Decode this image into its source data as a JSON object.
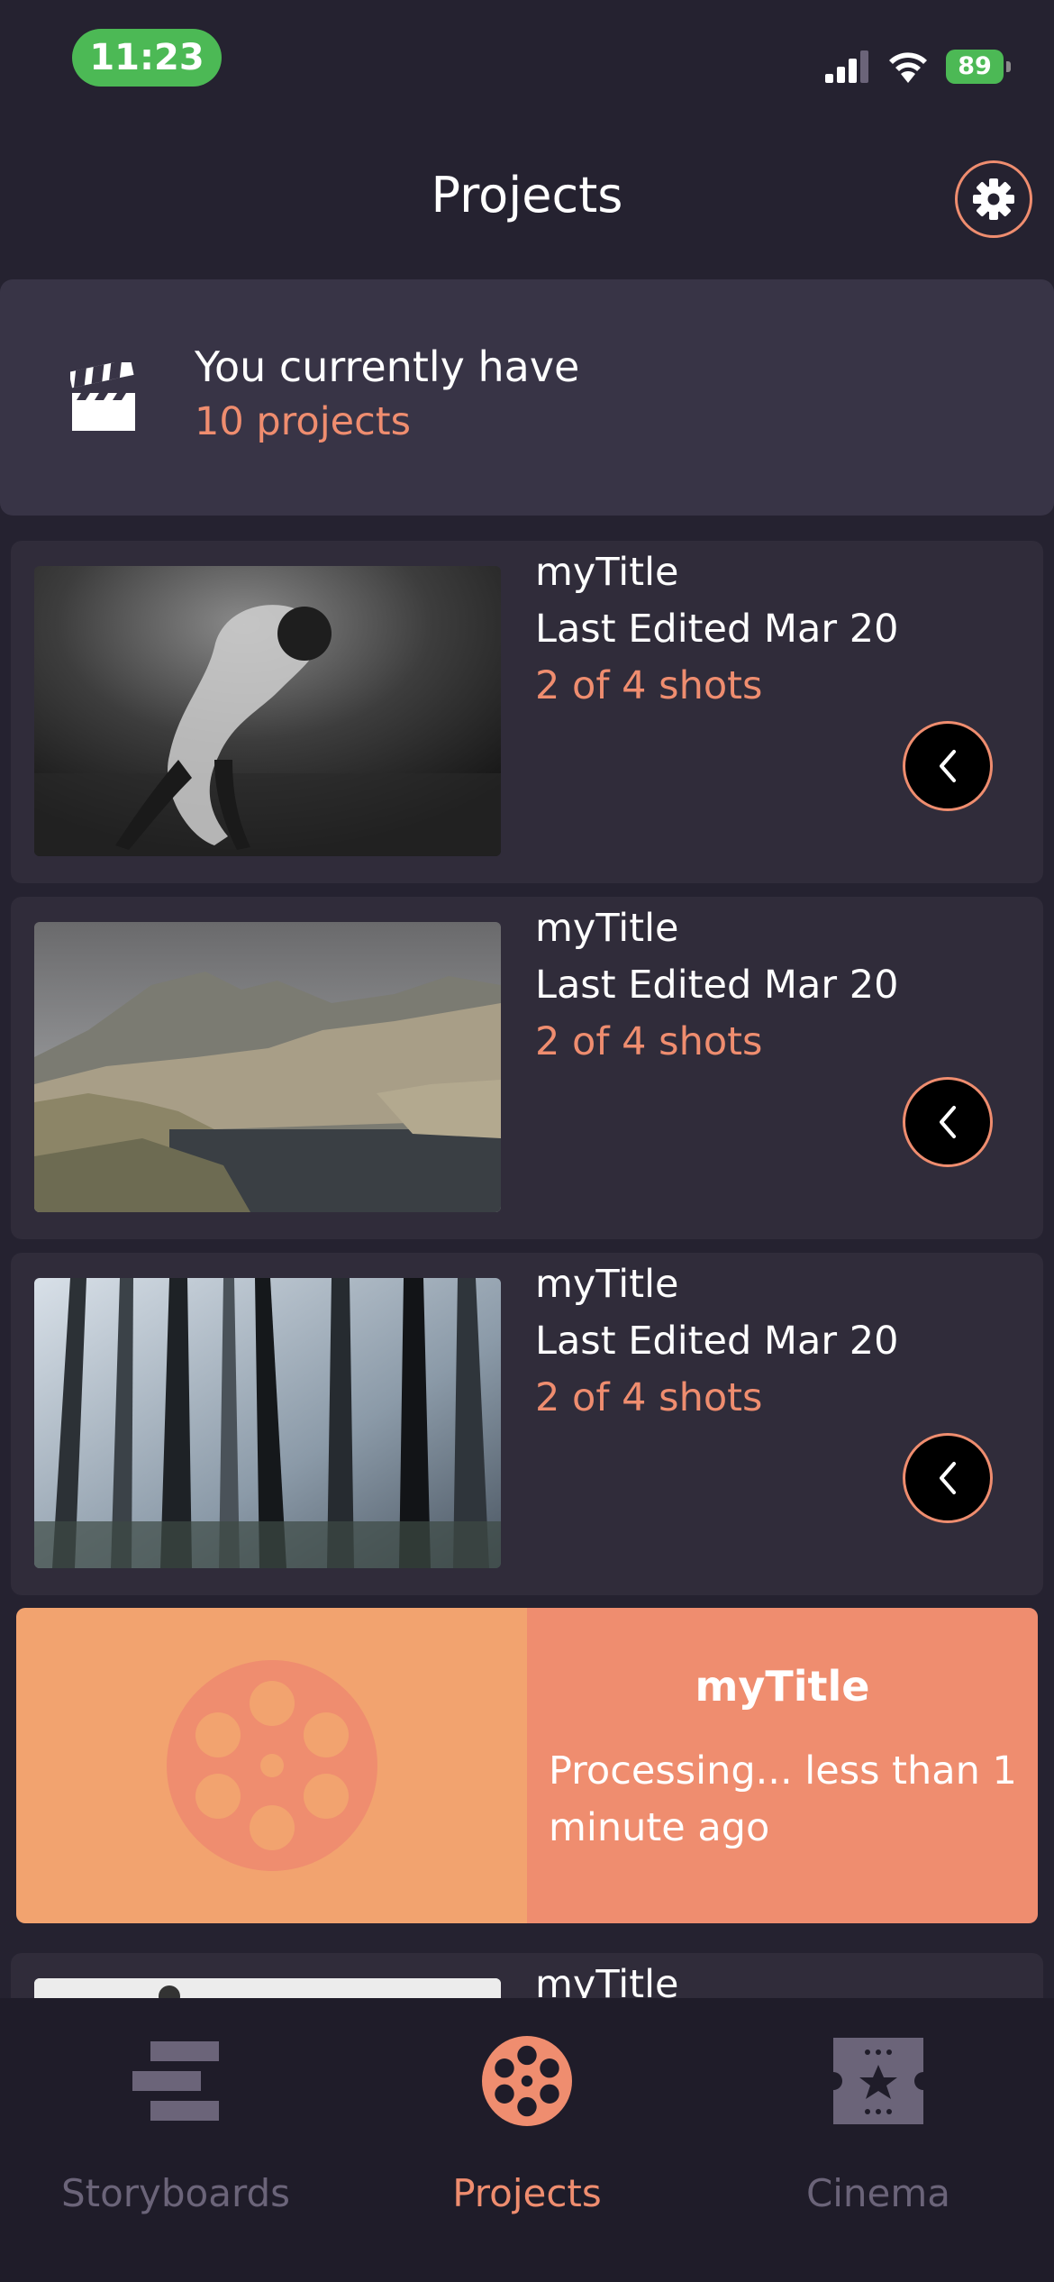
{
  "status_bar": {
    "time": "11:23",
    "battery": "89"
  },
  "header": {
    "title": "Projects"
  },
  "summary": {
    "line1": "You currently have",
    "line2": "10 projects"
  },
  "projects": [
    {
      "title": "myTitle",
      "edited": "Last Edited Mar 20",
      "shots": "2 of 4 shots"
    },
    {
      "title": "myTitle",
      "edited": "Last Edited Mar 20",
      "shots": "2 of 4 shots"
    },
    {
      "title": "myTitle",
      "edited": "Last Edited Mar 20",
      "shots": "2 of 4 shots"
    },
    {
      "title": "myTitle"
    }
  ],
  "processing": {
    "title": "myTitle",
    "status": "Processing... less than 1 minute ago"
  },
  "tabs": [
    {
      "label": "Storyboards",
      "icon": "storyboards-icon"
    },
    {
      "label": "Projects",
      "icon": "film-reel-icon",
      "active": true
    },
    {
      "label": "Cinema",
      "icon": "ticket-star-icon"
    }
  ],
  "colors": {
    "accent": "#ef8d6f",
    "background": "#252230",
    "card": "#302c3a",
    "processing_left": "#f2a36f"
  }
}
